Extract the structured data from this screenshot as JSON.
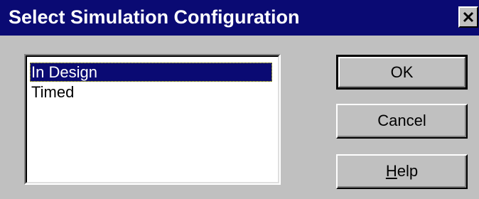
{
  "window": {
    "title": "Select Simulation Configuration",
    "close_icon": "close-icon"
  },
  "config_list": {
    "items": [
      {
        "label": "In Design",
        "selected": true
      },
      {
        "label": "Timed",
        "selected": false
      }
    ]
  },
  "buttons": {
    "ok_label": "OK",
    "cancel_label": "Cancel",
    "help_mnemonic": "H",
    "help_rest": "elp"
  },
  "colors": {
    "titlebar": "#0a0a73",
    "face": "#c0c0c0",
    "selection": "#0a0a73"
  }
}
